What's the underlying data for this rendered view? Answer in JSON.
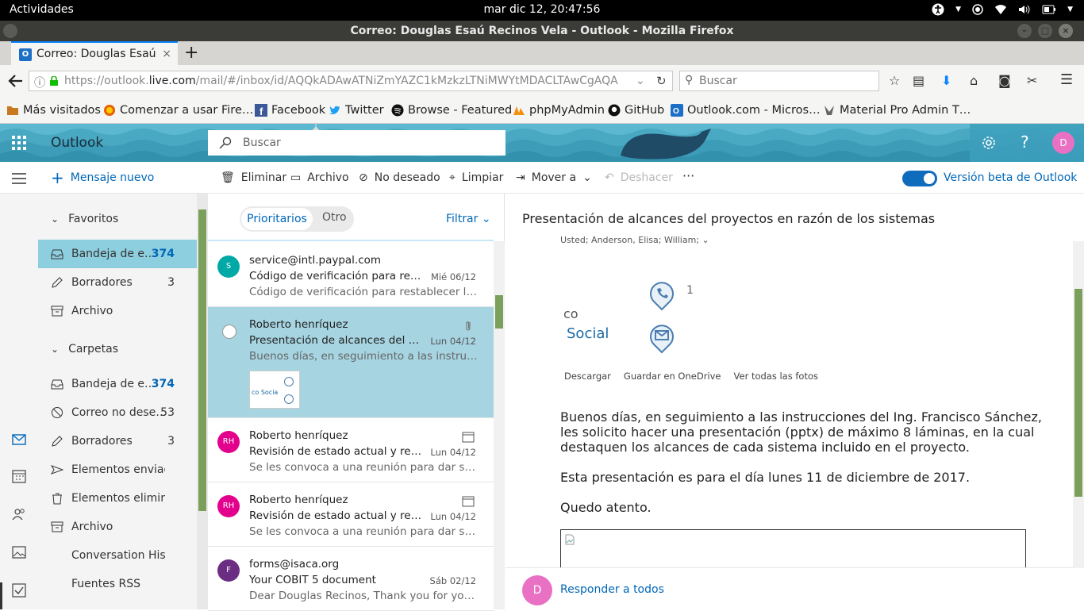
{
  "system": {
    "activities": "Actividades",
    "clock": "mar dic 12, 20:47:56"
  },
  "window": {
    "title": "Correo: Douglas Esaú Recinos Vela - Outlook - Mozilla Firefox"
  },
  "tab": {
    "title": "Correo: Douglas Esaú",
    "favicon_letter": "O"
  },
  "nav": {
    "url_prefix": "https://outlook.",
    "url_domain": "live.com",
    "url_rest": "/mail/#/inbox/id/AQQkADAwATNiZmYAZC1kMzkzLTNiMWYtMDACLTAwCgAQA",
    "search_placeholder": "Buscar"
  },
  "bookmarks": [
    {
      "label": "Más visitados",
      "icon": "folder-icon"
    },
    {
      "label": "Comenzar a usar Fire…",
      "icon": "firefox-icon"
    },
    {
      "label": "Facebook",
      "icon": "facebook-icon"
    },
    {
      "label": "Twitter",
      "icon": "twitter-icon"
    },
    {
      "label": "Browse - Featured",
      "icon": "spotify-icon"
    },
    {
      "label": "phpMyAdmin",
      "icon": "phpmyadmin-icon"
    },
    {
      "label": "GitHub",
      "icon": "github-icon"
    },
    {
      "label": "Outlook.com - Micros…",
      "icon": "outlook-icon"
    },
    {
      "label": "Material Pro Admin T…",
      "icon": "material-icon"
    }
  ],
  "outlook": {
    "app_name": "Outlook",
    "search_placeholder": "Buscar",
    "user_initial": "D",
    "header_color": "#5bb8d0"
  },
  "commands": {
    "new_message": "Mensaje nuevo",
    "delete": "Eliminar",
    "archive": "Archivo",
    "junk": "No deseado",
    "sweep": "Limpiar",
    "move_to": "Mover a",
    "undo": "Deshacer",
    "more": "···",
    "beta_label": "Versión beta de Outlook"
  },
  "folders": {
    "favorites_header": "Favoritos",
    "favorites": [
      {
        "label": "Bandeja de e…",
        "count": "374",
        "icon": "inbox-icon",
        "selected": true
      },
      {
        "label": "Borradores",
        "count": "3",
        "icon": "pencil-icon"
      },
      {
        "label": "Archivo",
        "count": "",
        "icon": "archive-icon"
      }
    ],
    "folders_header": "Carpetas",
    "items": [
      {
        "label": "Bandeja de e…",
        "count": "374",
        "icon": "inbox-icon"
      },
      {
        "label": "Correo no dese…",
        "count": "53",
        "icon": "block-icon"
      },
      {
        "label": "Borradores",
        "count": "3",
        "icon": "pencil-icon"
      },
      {
        "label": "Elementos enviad…",
        "count": "",
        "icon": "send-icon"
      },
      {
        "label": "Elementos elimin…",
        "count": "",
        "icon": "trash-icon"
      },
      {
        "label": "Archivo",
        "count": "",
        "icon": "archive-icon"
      },
      {
        "label": "Conversation Hist…",
        "count": "",
        "icon": ""
      },
      {
        "label": "Fuentes RSS",
        "count": "",
        "icon": ""
      }
    ]
  },
  "list": {
    "tab_focused": "Prioritarios",
    "tab_other": "Otro",
    "filter": "Filtrar",
    "messages": [
      {
        "initials": "S",
        "color": "#00a9a5",
        "from": "service@intl.paypal.com",
        "subject": "Código de verificación para restab…",
        "date": "Mié 06/12",
        "preview": "Código de verificación para restablecer la con…"
      },
      {
        "initials": "",
        "color": "",
        "from": "Roberto henríquez",
        "subject": "Presentación de alcances del proy…",
        "date": "Lun 04/12",
        "preview": "Buenos días, en seguimiento a las instruccion…",
        "selected": true,
        "thumb_text": "co Socia"
      },
      {
        "initials": "RH",
        "color": "#e3008c",
        "from": "Roberto henríquez",
        "subject": "Revisión de estado actual y reque…",
        "date": "Lun 04/12",
        "preview": "Se les convoca a una reunión para dar segui…"
      },
      {
        "initials": "RH",
        "color": "#e3008c",
        "from": "Roberto henríquez",
        "subject": "Revisión de estado actual y reque…",
        "date": "Lun 04/12",
        "preview": "Se les convoca a una reunión para dar segui…"
      },
      {
        "initials": "F",
        "color": "#6b2d82",
        "from": "forms@isaca.org",
        "subject": "Your COBIT 5 document",
        "date": "Sáb 02/12",
        "preview": "Dear Douglas Recinos, Thank you for your in…"
      }
    ]
  },
  "reading": {
    "title": "Presentación de alcances del proyectos en razón de los sistemas",
    "recipients": "Usted; Anderson, Elisa; William;",
    "image_text_co": "co",
    "image_text_social": "Social",
    "image_digit": "1",
    "attachment_actions": [
      "Descargar",
      "Guardar en OneDrive",
      "Ver todas las fotos"
    ],
    "body": [
      "Buenos días, en seguimiento a las instrucciones del Ing. Francisco Sánchez, les solicito hacer una presentación (pptx) de máximo 8 láminas, en la cual destaquen los alcances de cada sistema  incluido en el proyecto.",
      "Esta presentación es para el día lunes 11 de diciembre de 2017.",
      "Quedo atento."
    ],
    "reply_all": "Responder a todos",
    "reply_initial": "D"
  }
}
